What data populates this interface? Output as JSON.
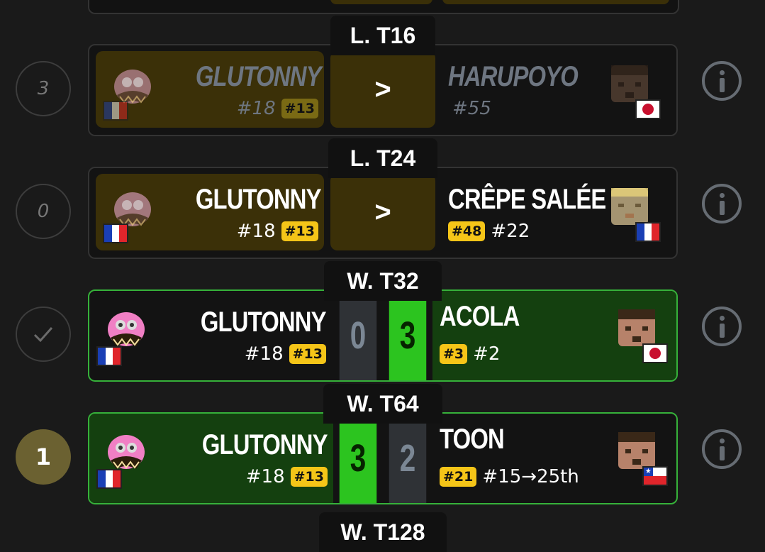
{
  "matches": [
    {
      "stage": "L. T16",
      "status": "3",
      "left": {
        "name": "GLUTONNY",
        "seed": "#18",
        "tag": "#13"
      },
      "right": {
        "name": "HARUPOYO",
        "seed": "#55"
      },
      "center": ">",
      "info_icon": "info-icon"
    },
    {
      "stage": "L. T24",
      "status": "0",
      "left": {
        "name": "GLUTONNY",
        "seed": "#18",
        "tag": "#13"
      },
      "right": {
        "name": "CRÊPE SALÉE",
        "seed": "#22",
        "tag": "#48"
      },
      "center": ">",
      "info_icon": "info-icon"
    },
    {
      "stage": "W. T32",
      "status_icon": "check-icon",
      "left": {
        "name": "GLUTONNY",
        "seed": "#18",
        "tag": "#13",
        "score": "0"
      },
      "right": {
        "name": "ACOLA",
        "seed": "#2",
        "tag": "#3",
        "score": "3"
      },
      "info_icon": "info-icon"
    },
    {
      "stage": "W. T64",
      "status": "1",
      "left": {
        "name": "GLUTONNY",
        "seed": "#18",
        "tag": "#13",
        "score": "3"
      },
      "right": {
        "name": "TOON",
        "seed": "#15→25th",
        "tag": "#21",
        "score": "2"
      },
      "info_icon": "info-icon"
    },
    {
      "stage": "W. T128"
    }
  ],
  "colors": {
    "accent_gold": "#f5c518",
    "win_green": "#2cc41f",
    "background": "#1a1a1a"
  }
}
